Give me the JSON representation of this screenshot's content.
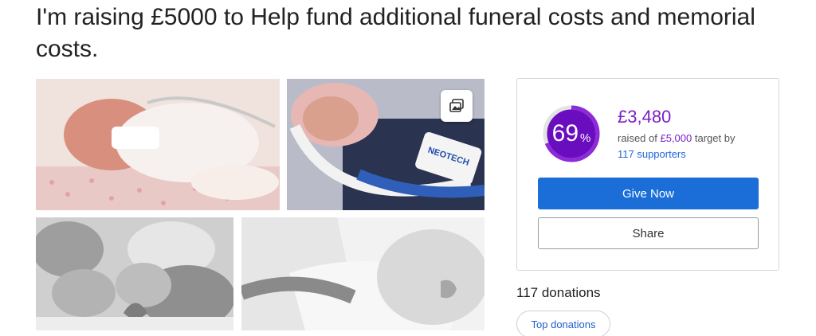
{
  "page": {
    "title": "I'm raising £5000 to Help fund additional funeral costs and memorial costs."
  },
  "gallery": {
    "button_icon": "image-gallery-icon",
    "photos": [
      {
        "name": "photo-premature-baby-incubator"
      },
      {
        "name": "photo-baby-pink-hat-ventilator"
      },
      {
        "name": "photo-baby-bw-knitted-toys"
      },
      {
        "name": "photo-pregnant-belly-bw"
      }
    ]
  },
  "fundraiser": {
    "progress_percent": 69,
    "progress_number": "69",
    "progress_symbol": "%",
    "raised": "£3,480",
    "raised_prefix": "raised of ",
    "target": "£5,000",
    "target_suffix": " target by",
    "supporters": "117 supporters",
    "give_label": "Give Now",
    "share_label": "Share",
    "colors": {
      "accent": "#7a20c9",
      "button": "#1b6ed8",
      "link": "#1f67d6"
    }
  },
  "donations": {
    "count_label": "117 donations",
    "top_label": "Top donations"
  }
}
